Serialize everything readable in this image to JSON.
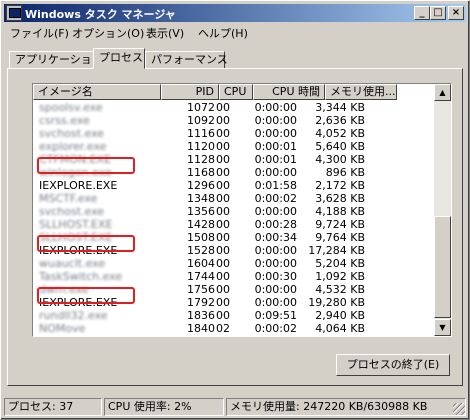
{
  "window": {
    "title": "Windows タスク マネージャ",
    "minimize": "_",
    "maximize": "□",
    "close": "×"
  },
  "menu": [
    "ファイル(F)",
    "オプション(O)",
    "表示(V)",
    "ヘルプ(H)"
  ],
  "tabs": [
    "アプリケーション",
    "プロセス",
    "パフォーマンス"
  ],
  "columns": [
    "イメージ名",
    "PID",
    "CPU",
    "CPU 時間",
    "メモリ使用..."
  ],
  "processes": [
    {
      "name": "spoolsv.exe",
      "pid": "1072",
      "cpu": "00",
      "time": "0:00:00",
      "mem": "3,344 KB",
      "blurred": true
    },
    {
      "name": "csrss.exe",
      "pid": "1092",
      "cpu": "00",
      "time": "0:00:00",
      "mem": "2,636 KB",
      "blurred": true
    },
    {
      "name": "svchost.exe",
      "pid": "1116",
      "cpu": "00",
      "time": "0:00:00",
      "mem": "4,052 KB",
      "blurred": true
    },
    {
      "name": "explorer.exe",
      "pid": "1120",
      "cpu": "00",
      "time": "0:00:01",
      "mem": "5,640 KB",
      "blurred": true
    },
    {
      "name": "CTFMON.EXE",
      "pid": "1128",
      "cpu": "00",
      "time": "0:00:01",
      "mem": "4,300 KB",
      "blurred": true
    },
    {
      "name": "winlogon.exe",
      "pid": "1168",
      "cpu": "00",
      "time": "0:00:00",
      "mem": "896 KB",
      "blurred": true
    },
    {
      "name": "IEXPLORE.EXE",
      "pid": "1296",
      "cpu": "00",
      "time": "0:01:58",
      "mem": "2,172 KB",
      "blurred": false
    },
    {
      "name": "MSCTF.exe",
      "pid": "1348",
      "cpu": "00",
      "time": "0:00:02",
      "mem": "3,628 KB",
      "blurred": true
    },
    {
      "name": "svchost.exe",
      "pid": "1356",
      "cpu": "00",
      "time": "0:00:00",
      "mem": "4,188 KB",
      "blurred": true
    },
    {
      "name": "SLLHOST.EXE",
      "pid": "1428",
      "cpu": "00",
      "time": "0:00:28",
      "mem": "9,724 KB",
      "blurred": true
    },
    {
      "name": "SLLHOST.EXE",
      "pid": "1508",
      "cpu": "00",
      "time": "0:00:34",
      "mem": "9,764 KB",
      "blurred": true
    },
    {
      "name": "IEXPLORE.EXE",
      "pid": "1528",
      "cpu": "00",
      "time": "0:00:00",
      "mem": "17,284 KB",
      "blurred": false
    },
    {
      "name": "wuauclt.exe",
      "pid": "1604",
      "cpu": "00",
      "time": "0:00:00",
      "mem": "5,204 KB",
      "blurred": true
    },
    {
      "name": "TaskSwitch.exe",
      "pid": "1744",
      "cpu": "00",
      "time": "0:00:30",
      "mem": "1,092 KB",
      "blurred": true
    },
    {
      "name": "dwm.exe",
      "pid": "1756",
      "cpu": "00",
      "time": "0:00:00",
      "mem": "4,532 KB",
      "blurred": true
    },
    {
      "name": "IEXPLORE.EXE",
      "pid": "1792",
      "cpu": "00",
      "time": "0:00:00",
      "mem": "19,280 KB",
      "blurred": false
    },
    {
      "name": "rundll32.exe",
      "pid": "1836",
      "cpu": "00",
      "time": "0:09:51",
      "mem": "2,940 KB",
      "blurred": true
    },
    {
      "name": "NOMove",
      "pid": "1840",
      "cpu": "02",
      "time": "0:00:02",
      "mem": "4,064 KB",
      "blurred": true
    }
  ],
  "end_process_button": "プロセスの終了(E)",
  "status": {
    "processes": "プロセス: 37",
    "cpu": "CPU 使用率: 2%",
    "memory": "メモリ使用量: 247220 KB/630988 KB"
  },
  "colors": {
    "highlight": "#e0201f",
    "title_start": "#0a246a",
    "title_end": "#a6caf0"
  }
}
